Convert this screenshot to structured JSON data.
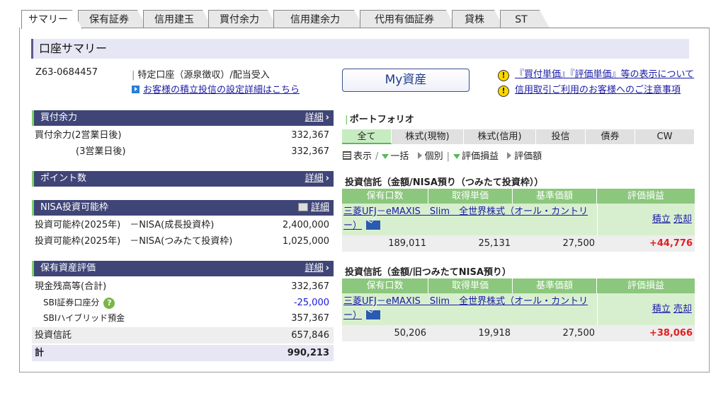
{
  "tabs": [
    "サマリー",
    "保有証券",
    "信用建玉",
    "買付余力",
    "信用建余力",
    "代用有価証券",
    "貸株",
    "ST"
  ],
  "page_title": "口座サマリー",
  "account": {
    "id": "Z63-0684457",
    "type": "特定口座（源泉徴収）/配当受入",
    "settings_link": "お客様の積立投信の設定詳細はこちら"
  },
  "my_assets_button": "My資産",
  "notices": [
    "『買付単価』『評価単価』等の表示について",
    "信用取引ご利用のお客様へのご注意事項"
  ],
  "detail_label": "詳細",
  "buying_power": {
    "title": "買付余力",
    "rows": [
      {
        "label": "買付余力(2営業日後)",
        "value": "332,367"
      },
      {
        "label": "(3営業日後)",
        "value": "332,367"
      }
    ]
  },
  "points": {
    "title": "ポイント数"
  },
  "nisa": {
    "title": "NISA投資可能枠",
    "rows": [
      {
        "label": "投資可能枠(2025年)　－NISA(成長投資枠)",
        "value": "2,400,000"
      },
      {
        "label": "投資可能枠(2025年)　－NISA(つみたて投資枠)",
        "value": "1,025,000"
      }
    ]
  },
  "holdings": {
    "title": "保有資産評価",
    "cash_label": "現金残高等(合計)",
    "cash_value": "332,367",
    "sbi_label": "SBI証券口座分",
    "sbi_value": "-25,000",
    "hybrid_label": "SBIハイブリッド預金",
    "hybrid_value": "357,367",
    "trust_label": "投資信託",
    "trust_value": "657,846",
    "total_label": "計",
    "total_value": "990,213"
  },
  "portfolio": {
    "title": "ポートフォリオ",
    "tabs": [
      "全て",
      "株式(現物)",
      "株式(信用)",
      "投信",
      "債券",
      "CW"
    ],
    "display_label": "表示",
    "options": [
      "一括",
      "個別",
      "評価損益",
      "評価額"
    ]
  },
  "columns": [
    "保有口数",
    "取得単価",
    "基準価額",
    "評価損益"
  ],
  "fund_sections": [
    {
      "title": "投資信託（金額/NISA預り（つみたて投資枠））",
      "fund_name": "三菱UFJ－eMAXIS　Slim　全世界株式（オール・カントリー）",
      "actions": [
        "積立",
        "売却"
      ],
      "units": "189,011",
      "cost": "25,131",
      "nav": "27,500",
      "gain": "+44,776"
    },
    {
      "title": "投資信託（金額/旧つみたてNISA預り）",
      "fund_name": "三菱UFJ－eMAXIS　Slim　全世界株式（オール・カントリー）",
      "actions": [
        "積立",
        "売却"
      ],
      "units": "50,206",
      "cost": "19,918",
      "nav": "27,500",
      "gain": "+38,066"
    }
  ]
}
